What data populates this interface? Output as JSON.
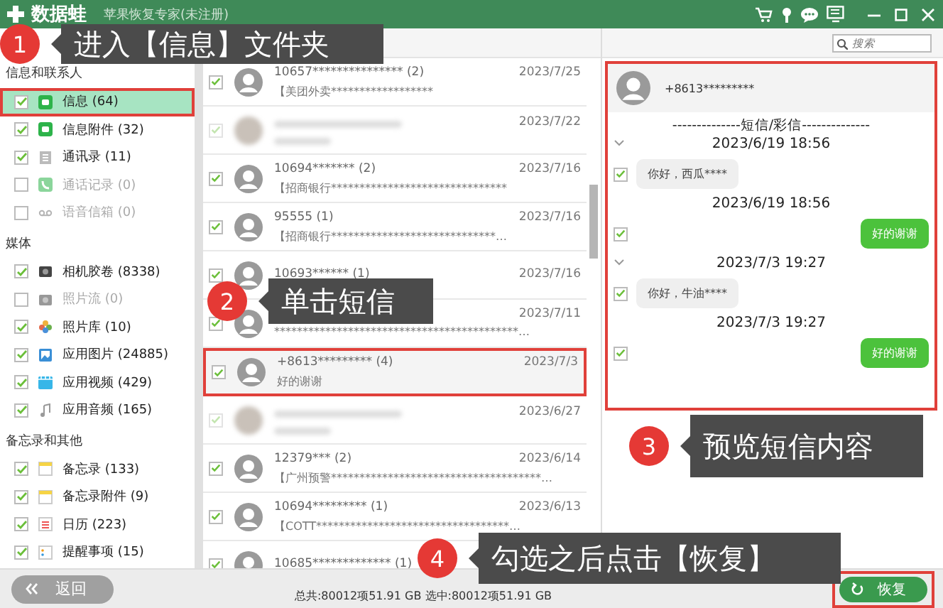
{
  "title_bar": {
    "logo": "数据蛙",
    "app_title": "苹果恢复专家(未注册)"
  },
  "search": {
    "placeholder": "搜索"
  },
  "sidebar": {
    "groups": [
      {
        "heading": "信息和联系人",
        "items": [
          {
            "label": "信息 (64)",
            "checked": true,
            "disabled": false,
            "selected": true
          },
          {
            "label": "信息附件 (32)",
            "checked": true,
            "disabled": false,
            "selected": false
          },
          {
            "label": "通讯录 (11)",
            "checked": true,
            "disabled": false,
            "selected": false
          },
          {
            "label": "通话记录 (0)",
            "checked": false,
            "disabled": true,
            "selected": false
          },
          {
            "label": "语音信箱 (0)",
            "checked": false,
            "disabled": true,
            "selected": false
          }
        ]
      },
      {
        "heading": "媒体",
        "items": [
          {
            "label": "相机胶卷 (8338)",
            "checked": true,
            "disabled": false,
            "selected": false
          },
          {
            "label": "照片流 (0)",
            "checked": false,
            "disabled": true,
            "selected": false
          },
          {
            "label": "照片库 (10)",
            "checked": true,
            "disabled": false,
            "selected": false
          },
          {
            "label": "应用图片 (24885)",
            "checked": true,
            "disabled": false,
            "selected": false
          },
          {
            "label": "应用视频 (429)",
            "checked": true,
            "disabled": false,
            "selected": false
          },
          {
            "label": "应用音频 (165)",
            "checked": true,
            "disabled": false,
            "selected": false
          }
        ]
      },
      {
        "heading": "备忘录和其他",
        "items": [
          {
            "label": "备忘录 (133)",
            "checked": true,
            "disabled": false,
            "selected": false
          },
          {
            "label": "备忘录附件 (9)",
            "checked": true,
            "disabled": false,
            "selected": false
          },
          {
            "label": "日历 (223)",
            "checked": true,
            "disabled": false,
            "selected": false
          },
          {
            "label": "提醒事项 (15)",
            "checked": true,
            "disabled": false,
            "selected": false
          }
        ]
      }
    ]
  },
  "message_list": {
    "rows": [
      {
        "kind": "normal",
        "name": "10657*************** (2)",
        "date": "2023/7/25",
        "preview": "【美团外卖******************",
        "checked": true,
        "selected": false
      },
      {
        "kind": "blurred",
        "date": "2023/7/22",
        "checked": true,
        "selected": false
      },
      {
        "kind": "normal",
        "name": "10694******* (2)",
        "date": "2023/7/16",
        "preview": "【招商银行*******************************",
        "checked": true,
        "selected": false
      },
      {
        "kind": "normal",
        "name": "95555 (1)",
        "date": "2023/7/16",
        "preview": "【招商银行*****************************…",
        "checked": true,
        "selected": false
      },
      {
        "kind": "normal",
        "name": "10693****** (1)",
        "date": "2023/7/16",
        "checked": true,
        "selected": false
      },
      {
        "kind": "normal",
        "date": "2023/7/11",
        "preview": "*******************************************…",
        "checked": true,
        "selected": false
      },
      {
        "kind": "normal",
        "name": "+8613********* (4)",
        "date": "2023/7/3",
        "preview": "好的谢谢",
        "checked": true,
        "selected": true
      },
      {
        "kind": "blurred",
        "date": "2023/6/27",
        "checked": true,
        "selected": false
      },
      {
        "kind": "normal",
        "name": "12379*** (2)",
        "date": "2023/6/14",
        "preview": "【广州预警*************************************…",
        "checked": true,
        "selected": false
      },
      {
        "kind": "normal",
        "name": "10694********* (1)",
        "date": "2023/6/13",
        "preview": "【COTT**********************************…",
        "checked": true,
        "selected": false
      },
      {
        "kind": "normal",
        "name": "10685************* (1)",
        "checked": true,
        "selected": false
      }
    ]
  },
  "preview": {
    "contact": "+8613*********",
    "items": [
      {
        "kind": "divider",
        "text": "--------------短信/彩信--------------"
      },
      {
        "kind": "group_time",
        "text": "2023/6/19 18:56"
      },
      {
        "kind": "received",
        "text": "你好，西瓜****",
        "checked": true
      },
      {
        "kind": "time",
        "text": "2023/6/19 18:56"
      },
      {
        "kind": "sent",
        "text": "好的谢谢",
        "checked": true
      },
      {
        "kind": "group_time",
        "text": "2023/7/3 19:27"
      },
      {
        "kind": "received",
        "text": "你好，牛油****",
        "checked": true
      },
      {
        "kind": "time",
        "text": "2023/7/3 19:27"
      },
      {
        "kind": "sent",
        "text": "好的谢谢",
        "checked": true
      }
    ]
  },
  "footer": {
    "back_button": "返回",
    "status": "总共:80012项51.91 GB 选中:80012项51.91 GB",
    "restore_button": "恢复"
  },
  "callouts": [
    {
      "number": "1",
      "text": "进入【信息】文件夹"
    },
    {
      "number": "2",
      "text": "单击短信"
    },
    {
      "number": "3",
      "text": "预览短信内容"
    },
    {
      "number": "4",
      "text": "勾选之后点击【恢复】"
    }
  ]
}
